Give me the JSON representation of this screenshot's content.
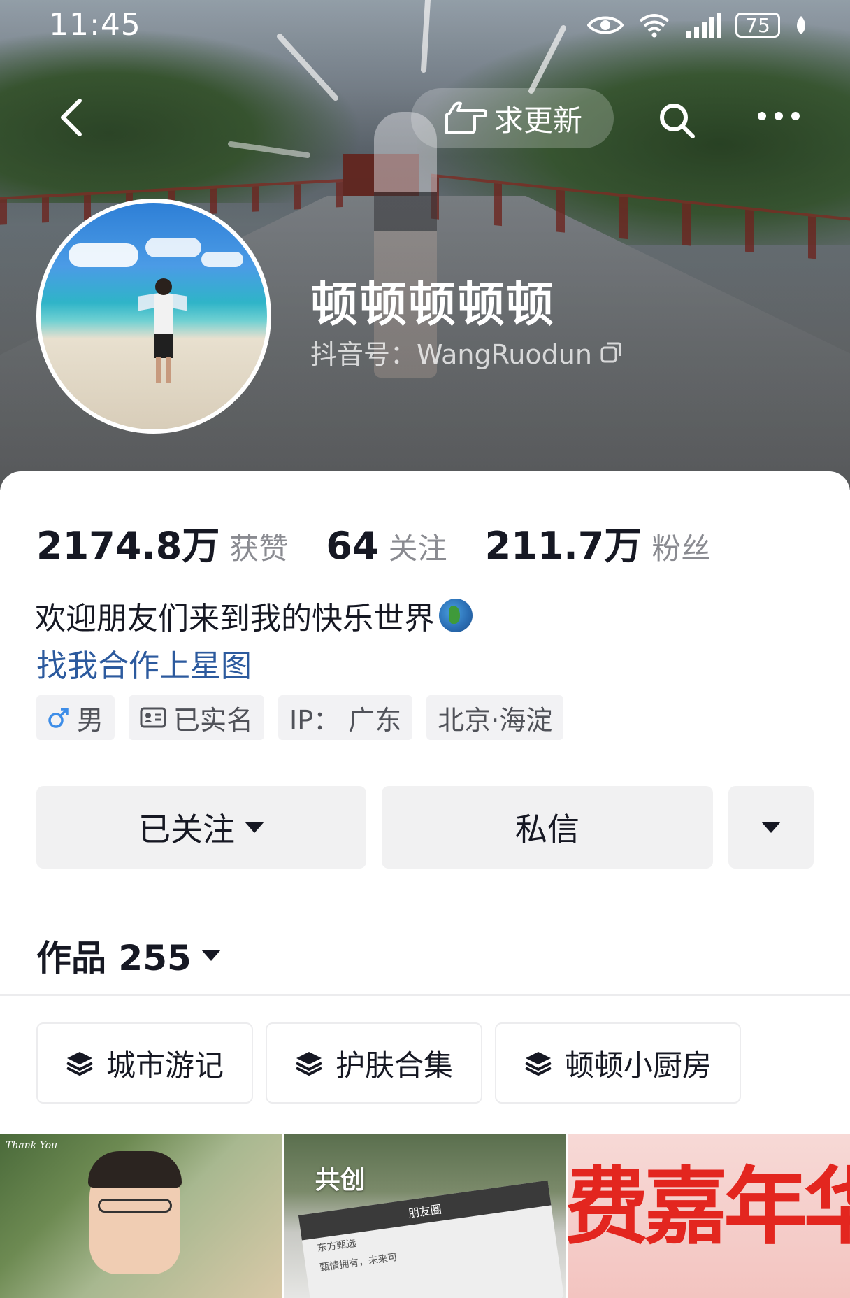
{
  "status_bar": {
    "time": "11:45",
    "battery": "75"
  },
  "header": {
    "request_update_label": "求更新",
    "nickname": "顿顿顿顿顿",
    "douyin_id": "抖音号：WangRuodun"
  },
  "stats": {
    "likes": {
      "value": "2174.8万",
      "label": "获赞"
    },
    "following": {
      "value": "64",
      "label": "关注"
    },
    "followers": {
      "value": "211.7万",
      "label": "粉丝"
    }
  },
  "bio": {
    "text": "欢迎朋友们来到我的快乐世界",
    "emoji_icon": "globe-icon",
    "collab_link": "找我合作上星图"
  },
  "tags": [
    {
      "icon": "male-icon",
      "label": "男"
    },
    {
      "icon": "id-card-icon",
      "label": "已实名"
    },
    {
      "label": "IP：  广东"
    },
    {
      "label": "北京·海淀"
    }
  ],
  "actions": {
    "follow_label": "已关注",
    "message_label": "私信"
  },
  "works": {
    "title": "作品 255"
  },
  "collections": [
    {
      "icon": "layers-icon",
      "label": "城市游记"
    },
    {
      "icon": "layers-icon",
      "label": "护肤合集"
    },
    {
      "icon": "layers-icon",
      "label": "顿顿小厨房"
    }
  ],
  "videos": [
    {
      "caption": "Thank You"
    },
    {
      "label": "共创",
      "card_title": "朋友圈",
      "card_line1": "东方甄选",
      "card_line2": "甄情拥有，未来可"
    },
    {
      "text": "费嘉年华"
    }
  ],
  "colors": {
    "link_blue": "#2c5a9e",
    "male_icon_blue": "#3d8de8",
    "button_bg": "#f1f1f2",
    "text_primary": "#161823",
    "text_secondary": "#8a8b91"
  }
}
